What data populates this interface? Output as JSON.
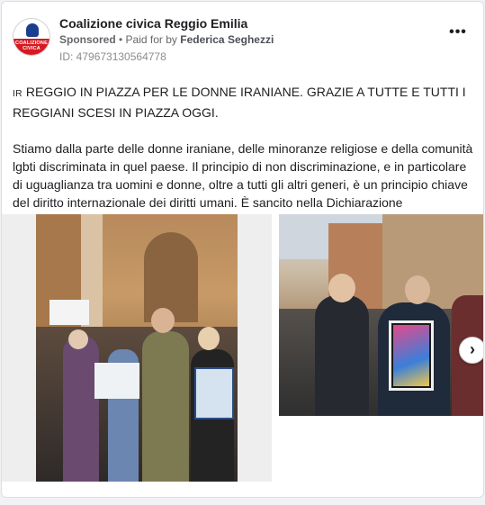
{
  "post": {
    "page_name": "Coalizione civica Reggio Emilia",
    "avatar_text": "COALIZIONE CIVICA",
    "sponsored": "Sponsored",
    "paid_for_prefix": " • Paid for by ",
    "payer": "Federica Seghezzi",
    "ad_id": "ID: 479673130564778",
    "more_label": "•••",
    "flag": "IR",
    "headline": " REGGIO IN PIAZZA PER LE DONNE IRANIANE. GRAZIE A TUTTE E TUTTI I REGGIANI SCESI IN PIAZZA OGGI.",
    "body": "Stiamo dalla parte delle donne iraniane, delle minoranze religiose e della comunità lgbti discriminata in quel paese. Il principio di non discriminazione, e in particolare di uguaglianza tra uomini e donne, oltre a tutti gli altri generi, è un principio chiave del diritto internazionale dei diritti umani. È sancito nella Dichiarazione universale…"
  },
  "gallery": {
    "next_arrow": "›"
  }
}
